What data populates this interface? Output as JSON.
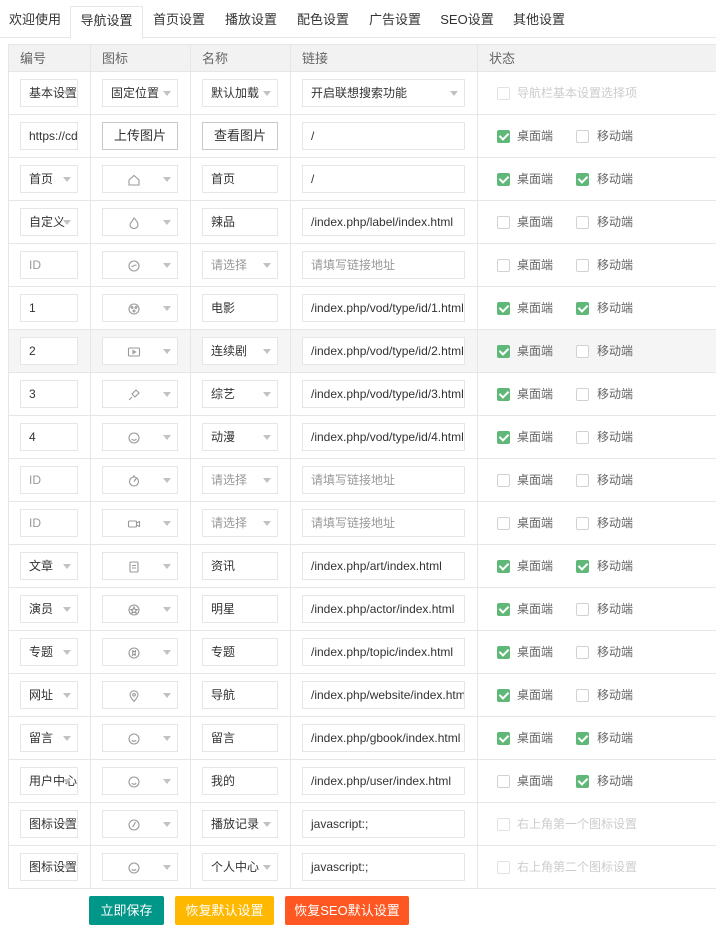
{
  "tabs": [
    "欢迎使用",
    "导航设置",
    "首页设置",
    "播放设置",
    "配色设置",
    "广告设置",
    "SEO设置",
    "其他设置"
  ],
  "active_tab": 1,
  "headers": [
    "编号",
    "图标",
    "名称",
    "链接",
    "状态"
  ],
  "rows": [
    {
      "id": "基本设置",
      "id_sel": true,
      "icon_text": "固定位置",
      "name": "默认加载",
      "name_sel": true,
      "link": "开启联想搜索功能",
      "link_sel": true,
      "note": "导航栏基本设置选择项"
    },
    {
      "id": "https://cd",
      "upload": "上传图片",
      "view": "查看图片",
      "link": "/",
      "desk": true,
      "mobile": false
    },
    {
      "id": "首页",
      "id_sel": true,
      "icon": "home",
      "name": "首页",
      "link": "/",
      "desk": true,
      "mobile": true
    },
    {
      "id": "自定义",
      "id_sel": true,
      "icon": "flame",
      "name": "辣品",
      "link": "/index.php/label/index.html",
      "desk": false,
      "mobile": false
    },
    {
      "id_ph": "ID",
      "icon": "compass",
      "name_ph": "请选择",
      "name_sel": true,
      "link_ph": "请填写链接地址",
      "desk": false,
      "mobile": false
    },
    {
      "id": "1",
      "icon": "film",
      "name": "电影",
      "link": "/index.php/vod/type/id/1.html",
      "desk": true,
      "mobile": true
    },
    {
      "id": "2",
      "icon": "tv",
      "name": "连续剧",
      "name_sel": true,
      "link": "/index.php/vod/type/id/2.html",
      "desk": true,
      "mobile": false,
      "hl": true
    },
    {
      "id": "3",
      "icon": "mic",
      "name": "综艺",
      "name_sel": true,
      "link": "/index.php/vod/type/id/3.html",
      "desk": true,
      "mobile": false
    },
    {
      "id": "4",
      "icon": "smile",
      "name": "动漫",
      "name_sel": true,
      "link": "/index.php/vod/type/id/4.html",
      "desk": true,
      "mobile": false
    },
    {
      "id_ph": "ID",
      "icon": "gauge",
      "name_ph": "请选择",
      "name_sel": true,
      "link_ph": "请填写链接地址",
      "desk": false,
      "mobile": false
    },
    {
      "id_ph": "ID",
      "icon": "video",
      "name_ph": "请选择",
      "name_sel": true,
      "link_ph": "请填写链接地址",
      "desk": false,
      "mobile": false
    },
    {
      "id": "文章",
      "id_sel": true,
      "icon": "doc",
      "name": "资讯",
      "link": "/index.php/art/index.html",
      "desk": true,
      "mobile": true
    },
    {
      "id": "演员",
      "id_sel": true,
      "icon": "star",
      "name": "明星",
      "link": "/index.php/actor/index.html",
      "desk": true,
      "mobile": false
    },
    {
      "id": "专题",
      "id_sel": true,
      "icon": "topic",
      "name": "专题",
      "link": "/index.php/topic/index.html",
      "desk": true,
      "mobile": false
    },
    {
      "id": "网址",
      "id_sel": true,
      "icon": "pin",
      "name": "导航",
      "link": "/index.php/website/index.html",
      "desk": true,
      "mobile": false
    },
    {
      "id": "留言",
      "id_sel": true,
      "icon": "face",
      "name": "留言",
      "link": "/index.php/gbook/index.html",
      "desk": true,
      "mobile": true
    },
    {
      "id": "用户中心",
      "id_sel": true,
      "icon": "face",
      "name": "我的",
      "link": "/index.php/user/index.html",
      "desk": false,
      "mobile": true
    },
    {
      "id": "图标设置",
      "id_sel": true,
      "icon": "clock",
      "name": "播放记录",
      "name_sel": true,
      "link": "javascript:;",
      "note": "右上角第一个图标设置"
    },
    {
      "id": "图标设置",
      "id_sel": true,
      "icon": "face",
      "name": "个人中心",
      "name_sel": true,
      "link": "javascript:;",
      "note": "右上角第二个图标设置"
    }
  ],
  "labels": {
    "desk": "桌面端",
    "mobile": "移动端"
  },
  "actions": [
    {
      "label": "立即保存",
      "color": "#009688"
    },
    {
      "label": "恢复默认设置",
      "color": "#ffb800"
    },
    {
      "label": "恢复SEO默认设置",
      "color": "#ff5722"
    }
  ]
}
